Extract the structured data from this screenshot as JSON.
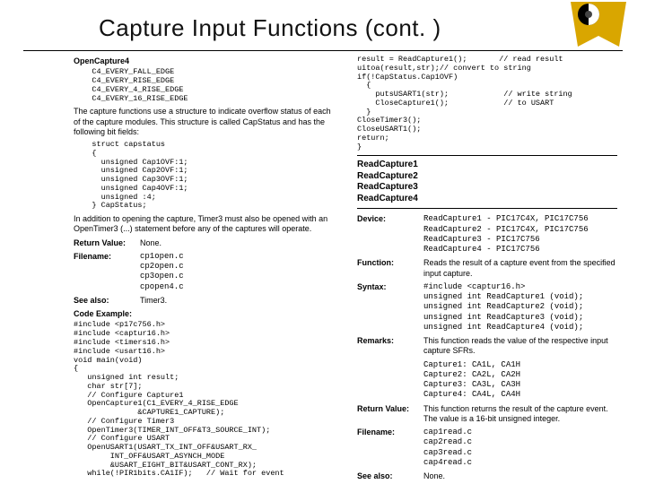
{
  "header": {
    "title": "Capture Input Functions (cont. )"
  },
  "left": {
    "opencapture4": "OpenCapture4",
    "edges": "    C4_EVERY_FALL_EDGE\n    C4_EVERY_RISE_EDGE\n    C4_EVERY_4_RISE_EDGE\n    C4_EVERY_16_RISE_EDGE",
    "cap_para": "The capture functions use a structure to indicate overflow status of each of the capture modules. This structure is called CapStatus and has the following bit fields:",
    "struct_code": "    struct capstatus\n    {\n      unsigned Cap1OVF:1;\n      unsigned Cap2OVF:1;\n      unsigned Cap3OVF:1;\n      unsigned Cap4OVF:1;\n      unsigned :4;\n    } CapStatus;",
    "open_para": "In addition to opening the capture, Timer3 must also be opened with an OpenTimer3 (...) statement before any of the captures will operate.",
    "retval_l": "Return Value:",
    "retval_v": "None.",
    "file_l": "Filename:",
    "file_v": "cp1open.c\ncp2open.c\ncp3open.c\ncpopen4.c",
    "see_l": "See also:",
    "see_v": "Timer3.",
    "code_l": "Code Example:",
    "code_v": "#include <p17c756.h>\n#include <captur16.h>\n#include <timers16.h>\n#include <usart16.h>\nvoid main(void)\n{\n   unsigned int result;\n   char str[7];\n   // Configure Capture1\n   OpenCapture1(C1_EVERY_4_RISE_EDGE\n              &CAPTURE1_CAPTURE);\n   // Configure Timer3\n   OpenTimer3(TIMER_INT_OFF&T3_SOURCE_INT);\n   // Configure USART\n   OpenUSART1(USART_TX_INT_OFF&USART_RX_\n        INT_OFF&USART_ASYNCH_MODE\n        &USART_EIGHT_BIT&USART_CONT_RX);\n   while(!PIR1bits.CA1IF);   // Wait for event"
  },
  "right": {
    "top_code": "result = ReadCapture1();       // read result\nuitoa(result,str);// convert to string\nif(!CapStatus.Cap1OVF)\n  {\n    putsUSART1(str);            // write string\n    CloseCapture1();            // to USART\n  }\nCloseTimer3();\nCloseUSART1();\nreturn;\n}",
    "box": [
      "ReadCapture1",
      "ReadCapture2",
      "ReadCapture3",
      "ReadCapture4"
    ],
    "dev_l": "Device:",
    "dev_v": "ReadCapture1 - PIC17C4X, PIC17C756\nReadCapture2 - PIC17C4X, PIC17C756\nReadCapture3 - PIC17C756\nReadCapture4 - PIC17C756",
    "func_l": "Function:",
    "func_v": "Reads the result of a capture event from the specified input capture.",
    "syn_l": "Syntax:",
    "syn_v": "#include <captur16.h>\nunsigned int ReadCapture1 (void);\nunsigned int ReadCapture2 (void);\nunsigned int ReadCapture3 (void);\nunsigned int ReadCapture4 (void);",
    "rem_l": "Remarks:",
    "rem_v": "This function reads the value of the respective input capture SFRs.",
    "rem_v2": "Capture1: CA1L, CA1H\nCapture2: CA2L, CA2H\nCapture3: CA3L, CA3H\nCapture4: CA4L, CA4H",
    "ret_l": "Return Value:",
    "ret_v": "This function returns the result of the capture event. The value is a 16-bit unsigned integer.",
    "file_l": "Filename:",
    "file_v": "cap1read.c\ncap2read.c\ncap3read.c\ncap4read.c",
    "see_l": "See also:",
    "see_v": "None."
  }
}
